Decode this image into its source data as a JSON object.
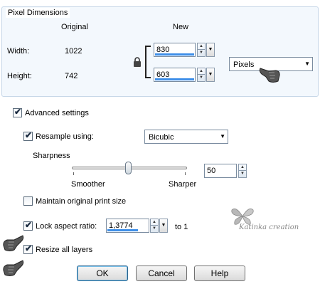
{
  "pixel_dimensions": {
    "group_label": "Pixel Dimensions",
    "col_original": "Original",
    "col_new": "New",
    "width_label": "Width:",
    "width_original": "1022",
    "width_new": "830",
    "height_label": "Height:",
    "height_original": "742",
    "height_new": "603",
    "units_value": "Pixels"
  },
  "advanced": {
    "label": "Advanced settings",
    "checked": true
  },
  "resample": {
    "label": "Resample using:",
    "checked": true,
    "method_value": "Bicubic"
  },
  "sharpness": {
    "label": "Sharpness",
    "min_label": "Smoother",
    "max_label": "Sharper",
    "value": "50",
    "level": 0.5
  },
  "maintain_print": {
    "label": "Maintain original print size",
    "checked": false
  },
  "lock_aspect": {
    "label": "Lock aspect ratio:",
    "checked": true,
    "ratio_value": "1,3774",
    "to_label": "to 1"
  },
  "resize_layers": {
    "label": "Resize all layers",
    "checked": true
  },
  "buttons": {
    "ok": "OK",
    "cancel": "Cancel",
    "help": "Help"
  },
  "watermark": "Katinka creation",
  "icons": {
    "lock": "lock-icon",
    "pointer": "pointing-hand-icon",
    "butterfly": "butterfly-icon",
    "spin_up": "▲",
    "spin_down": "▼",
    "dropdown": "▼",
    "check": "✔"
  }
}
